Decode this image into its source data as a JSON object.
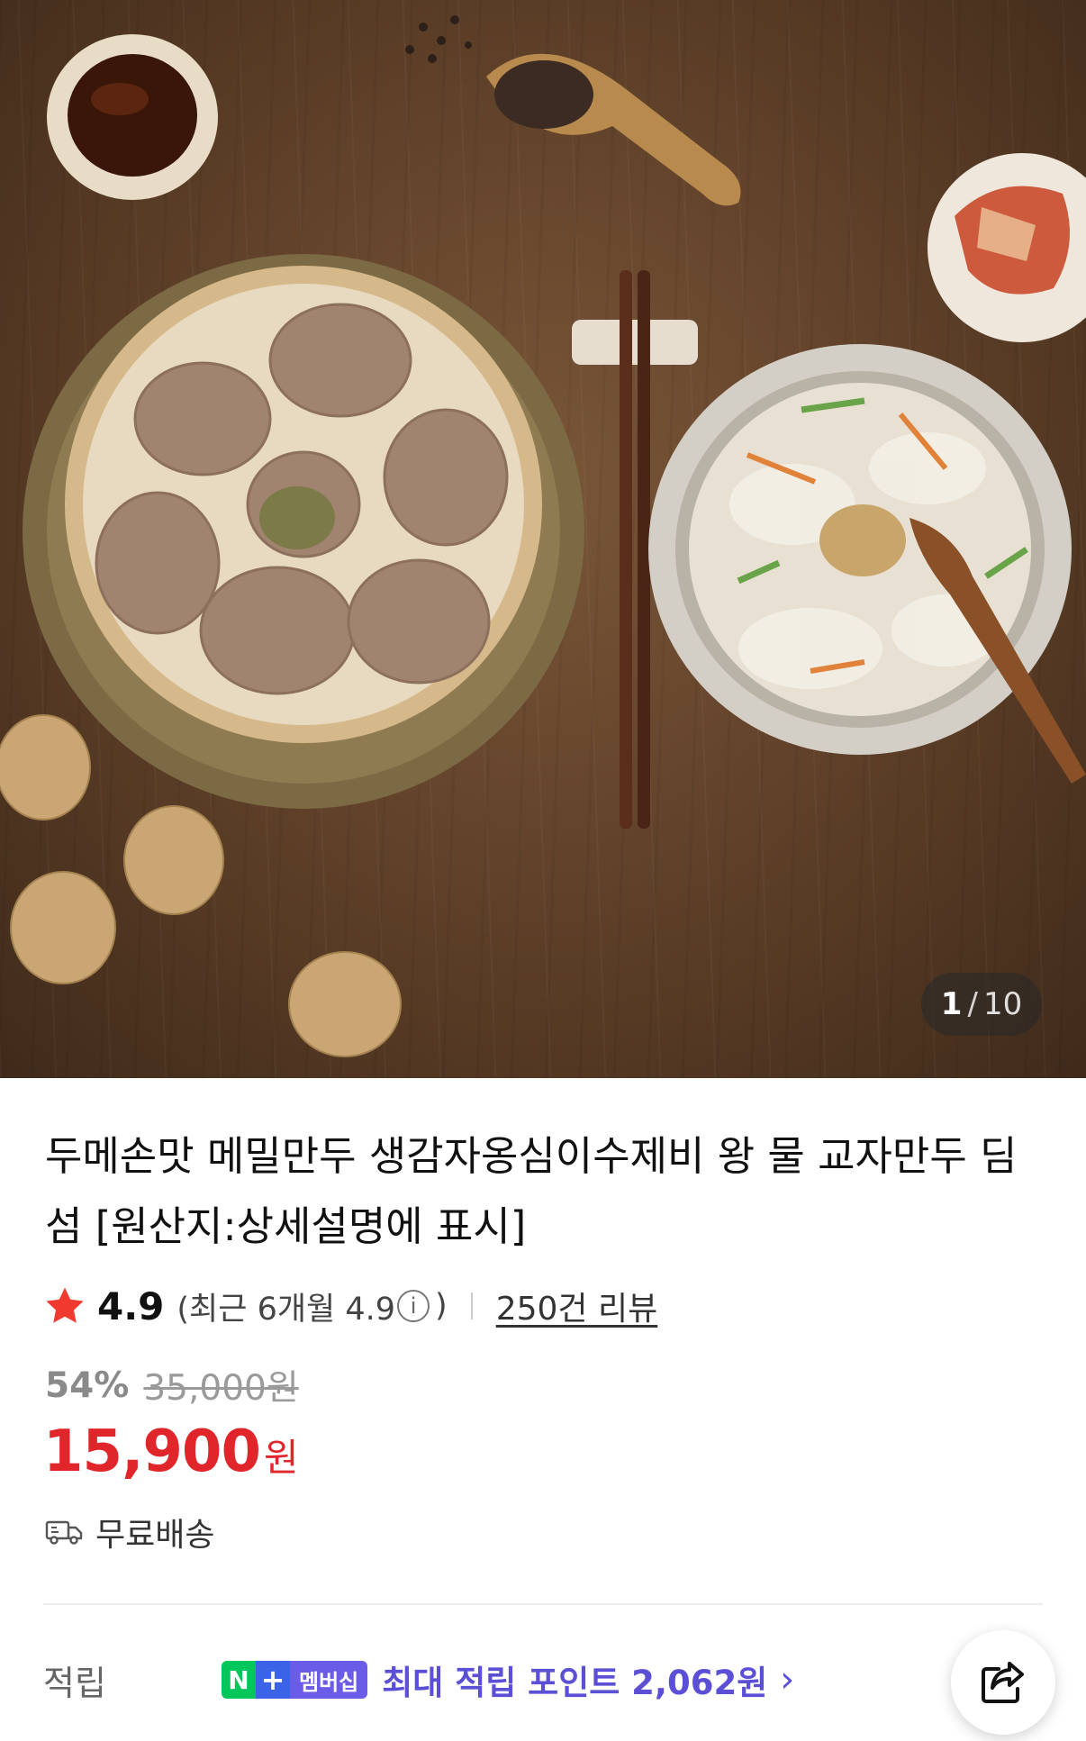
{
  "gallery": {
    "current": "1",
    "separator": "/",
    "total": "10"
  },
  "product": {
    "title": "두메손맛 메밀만두 생감자옹심이수제비 왕 물 교자만두 딤섬 [원산지:상세설명에 표시]"
  },
  "rating": {
    "score": "4.9",
    "recent": "(최근 6개월 4.9",
    "info_glyph": "i",
    "recent_close": ")",
    "reviews": "250건 리뷰"
  },
  "price": {
    "discount": "54%",
    "original": "35,000원",
    "sale": "15,900",
    "currency": "원"
  },
  "shipping": {
    "label": "무료배송"
  },
  "points": {
    "label": "적립",
    "badge_n": "N",
    "badge_plus": "+",
    "badge_text": "멤버십",
    "text": "최대 적립 포인트 2,062원",
    "chevron": "›"
  },
  "colors": {
    "sale_red": "#e0262b",
    "naver_green": "#03c75a",
    "membership_purple": "#5b4fd6",
    "star_red": "#f03a2f"
  }
}
